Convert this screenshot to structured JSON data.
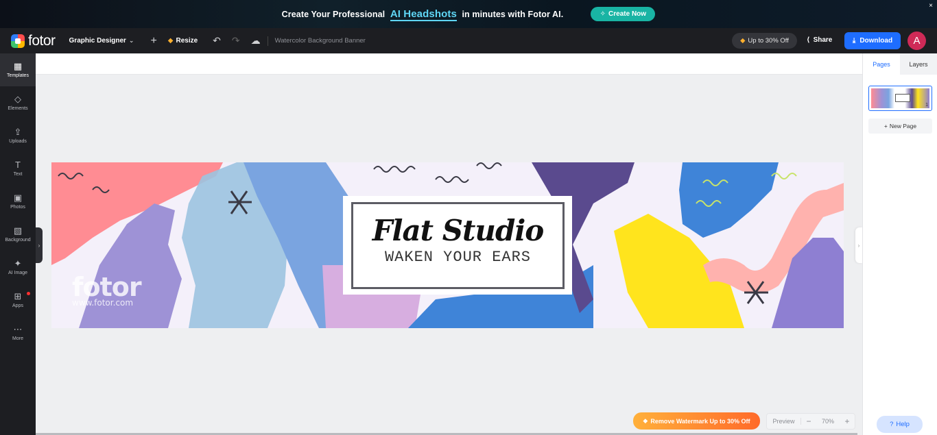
{
  "promo": {
    "text_before": "Create Your Professional",
    "highlight": "AI Headshots",
    "text_after": "in minutes with Fotor AI.",
    "cta": "Create Now",
    "close": "×"
  },
  "header": {
    "logo": "fotor",
    "mode": "Graphic Designer",
    "add": "+",
    "resize": "Resize",
    "doc_name": "Watercolor Background Banner",
    "offer": "Up to 30% Off",
    "share": "Share",
    "download": "Download",
    "avatar": "A"
  },
  "sidebar": {
    "items": [
      {
        "label": "Templates",
        "icon": "▦"
      },
      {
        "label": "Elements",
        "icon": "◇"
      },
      {
        "label": "Uploads",
        "icon": "⇪"
      },
      {
        "label": "Text",
        "icon": "T"
      },
      {
        "label": "Photos",
        "icon": "▣"
      },
      {
        "label": "Background",
        "icon": "▧"
      },
      {
        "label": "AI Image",
        "icon": "✦"
      },
      {
        "label": "Apps",
        "icon": "⊞"
      },
      {
        "label": "More",
        "icon": "⋯"
      }
    ]
  },
  "canvas": {
    "title": "Flat Studio",
    "subtitle": "WAKEN YOUR EARS",
    "watermark": "fotor",
    "watermark_url": "www.fotor.com",
    "colors": {
      "pink": "#ff8c93",
      "purple": "#9e92d6",
      "blue": "#7aa4e0",
      "navy": "#5a4a8e",
      "yellow": "#ffe41d",
      "sky": "#3f84d8",
      "lilac": "#d7aee0",
      "peach": "#ffb2ae"
    }
  },
  "right_panel": {
    "tab_pages": "Pages",
    "tab_layers": "Layers",
    "new_page": "New Page",
    "page_number": "1"
  },
  "bottom": {
    "remove_watermark": "Remove Watermark Up to 30% Off",
    "preview": "Preview",
    "zoom_minus": "−",
    "zoom": "70%",
    "zoom_plus": "+",
    "help": "Help"
  }
}
